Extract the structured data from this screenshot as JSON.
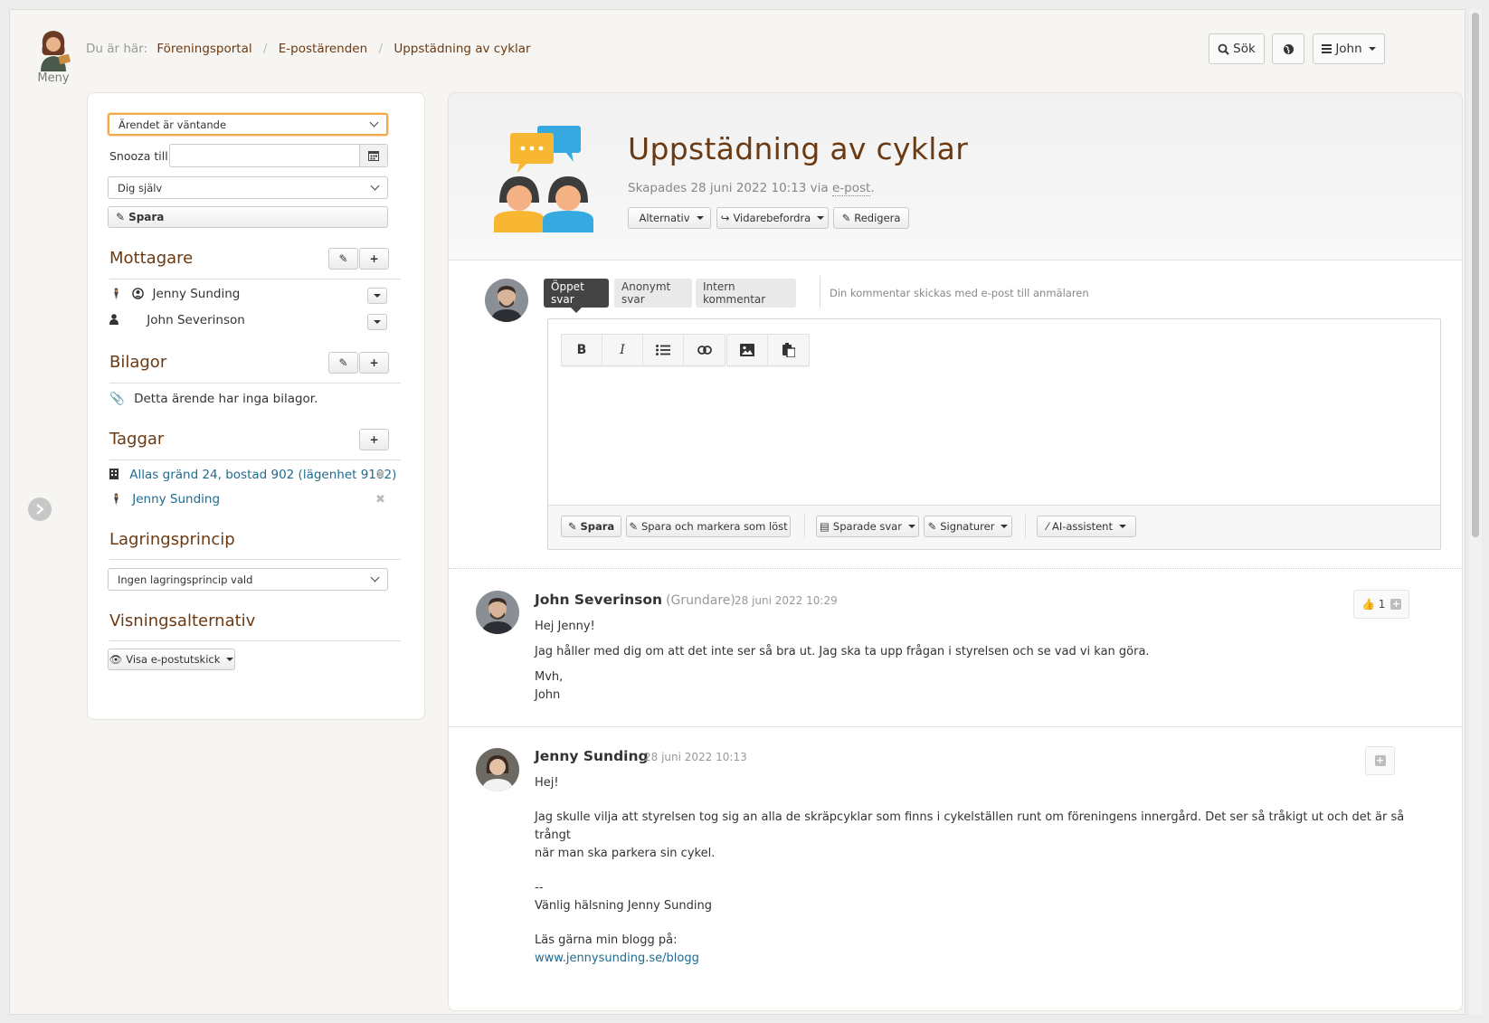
{
  "header": {
    "menu_label": "Meny",
    "breadcrumb_prefix": "Du är här:",
    "breadcrumbs": [
      "Föreningsportal",
      "E-postärenden",
      "Uppstädning av cyklar"
    ],
    "search_label": "Sök",
    "user_label": "John"
  },
  "sidebar": {
    "status_select": "Ärendet är väntande",
    "snooze_label": "Snooza till",
    "snooze_value": "",
    "assignee_select": "Dig själv",
    "save_label": "Spara",
    "recipients_title": "Mottagare",
    "recipients": [
      {
        "name": "Jenny Sunding"
      },
      {
        "name": "John Severinson"
      }
    ],
    "attachments_title": "Bilagor",
    "attachments_empty": "Detta ärende har inga bilagor.",
    "tags_title": "Taggar",
    "tags": [
      "Allas gränd 24, bostad 902 (lägenhet 9102)",
      "Jenny Sunding"
    ],
    "retention_title": "Lagringsprincip",
    "retention_select": "Ingen lagringsprincip vald",
    "view_title": "Visningsalternativ",
    "view_button": "Visa e-postutskick"
  },
  "ticket": {
    "title": "Uppstädning av cyklar",
    "created_prefix": "Skapades 28 juni 2022 10:13 via",
    "created_via": "e-post",
    "created_suffix": ".",
    "actions": {
      "options": "Alternativ",
      "forward": "Vidarebefordra",
      "edit": "Redigera"
    }
  },
  "reply": {
    "tabs": [
      "Öppet svar",
      "Anonymt svar",
      "Intern kommentar"
    ],
    "active_tab": "Öppet svar",
    "note": "Din kommentar skickas med e-post till anmälaren",
    "toolbar": {
      "bold": "B",
      "italic": "I"
    },
    "save_label": "Spara",
    "save_resolve_label": "Spara och markera som löst",
    "saved_replies_label": "Sparade svar",
    "signatures_label": "Signaturer",
    "ai_label": "AI-assistent"
  },
  "messages": [
    {
      "author": "John Severinson",
      "role": "(Grundare)",
      "date": "28 juni 2022 10:29",
      "reaction_count": "1",
      "lines": [
        "Hej Jenny!",
        "Jag håller med dig om att det inte ser så bra ut. Jag ska ta upp frågan i styrelsen och se vad vi kan göra.",
        "Mvh,",
        "John"
      ]
    },
    {
      "author": "Jenny Sunding",
      "role": "",
      "date": "28 juni 2022 10:13",
      "lines": [
        "Hej!",
        "Jag skulle vilja att styrelsen tog sig an alla de skräpcyklar som finns i cykelställen runt om föreningens innergård. Det ser så tråkigt ut och det är så trångt",
        "när man ska parkera sin cykel.",
        "--",
        "Vänlig hälsning Jenny Sunding",
        "Läs gärna min blogg på:",
        "www.jennysunding.se/blogg"
      ]
    }
  ],
  "colors": {
    "accent": "#6b3a12",
    "link": "#1f6b8e",
    "focus": "#f0a94b"
  }
}
